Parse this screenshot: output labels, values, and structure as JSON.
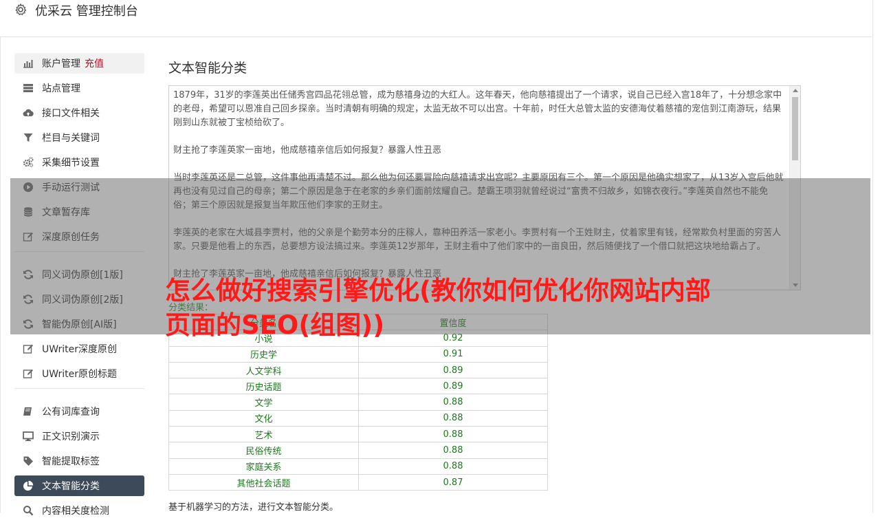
{
  "app": {
    "title": "优采云 管理控制台"
  },
  "sidebar": {
    "items": [
      {
        "label": "账户管理",
        "extra": "充值",
        "icon": "bar-chart-icon"
      },
      {
        "label": "站点管理",
        "icon": "server-icon"
      },
      {
        "label": "接口文件相关",
        "icon": "cloud-upload-icon"
      },
      {
        "label": "栏目与关键词",
        "icon": "filter-icon"
      },
      {
        "label": "采集细节设置",
        "icon": "cogs-icon"
      },
      {
        "label": "手动运行测试",
        "icon": "play-circle-icon"
      },
      {
        "label": "文章暂存库",
        "icon": "database-icon"
      },
      {
        "label": "深度原创任务",
        "icon": "edit-icon"
      },
      {
        "label": "同义词伪原创[1版]",
        "icon": "refresh-icon"
      },
      {
        "label": "同义词伪原创[2版]",
        "icon": "refresh-icon"
      },
      {
        "label": "智能伪原创[AI版]",
        "icon": "refresh-icon"
      },
      {
        "label": "UWriter深度原创",
        "icon": "edit-icon"
      },
      {
        "label": "UWriter原创标题",
        "icon": "edit-icon"
      },
      {
        "label": "公有词库查询",
        "icon": "book-icon"
      },
      {
        "label": "正文识别演示",
        "icon": "desktop-icon"
      },
      {
        "label": "智能提取标签",
        "icon": "tag-icon"
      },
      {
        "label": "文本智能分类",
        "icon": "pie-chart-icon"
      },
      {
        "label": "内容相关度检测",
        "icon": "search-icon"
      }
    ]
  },
  "main": {
    "title": "文本智能分类",
    "text_paragraphs": [
      "1879年，31岁的李莲英出任储秀宫四品花翎总管，成为慈禧身边的大红人。这年春天，他向慈禧提出了一个请求，说自己已经入宫18年了，十分想念家中的老母，希望可以恩准自己回乡探亲。当时清朝有明确的规定，太监无故不可以出宫。十年前，时任大总管太监的安德海仗着慈禧的宠信到江南游玩，结果刚到山东就被丁宝桢给砍了。",
      "财主抢了李莲英家一亩地，他成慈禧亲信后如何报复？暴露人性丑恶",
      "当时李莲英还是二总管，这件事他再清楚不过。那么他为何还要冒险向慈禧请求出宫呢？主要原因有三个。第一个原因是他确实想家了，从13岁入宫后他就再也没有见过自己的母亲；第二个原因是急于在老家的乡亲们面前炫耀自己。楚霸王项羽就曾经说过“富贵不归故乡，如锦衣夜行。”李莲英自然也不能免俗；第三个原因就是报复当年欺压他们李家的王财主。",
      "李莲英的老家在大城县李贾村，他的父亲是个勤劳本分的庄稼人，靠种田养活一家老小。李贾村有一个王姓财主，仗着家里有钱，经常欺负村里面的穷苦人家。只要是他看上的东西，总要想方设法搞过来。李莲英12岁那年，王财主看中了他们家中的一亩良田，然后随便找了一个借口就把这块地给霸占了。",
      "财主抢了李莲英家一亩地，他成慈禧亲信后如何报复？暴露人性丑恶"
    ],
    "result_label": "分类结果：",
    "table": {
      "headers": [
        "分类名",
        "置信度"
      ],
      "rows": [
        [
          "小说",
          "0.92"
        ],
        [
          "历史学",
          "0.91"
        ],
        [
          "人文学科",
          "0.89"
        ],
        [
          "历史话题",
          "0.89"
        ],
        [
          "文学",
          "0.88"
        ],
        [
          "文化",
          "0.88"
        ],
        [
          "艺术",
          "0.88"
        ],
        [
          "民俗传统",
          "0.88"
        ],
        [
          "家庭关系",
          "0.88"
        ],
        [
          "其他社会话题",
          "0.87"
        ]
      ]
    },
    "footnote": "基于机器学习的方法，进行文本智能分类。"
  },
  "overlay": {
    "headline": "怎么做好搜索引擎优化(教你如何优化你网站内部页面的SEO(组图))"
  }
}
